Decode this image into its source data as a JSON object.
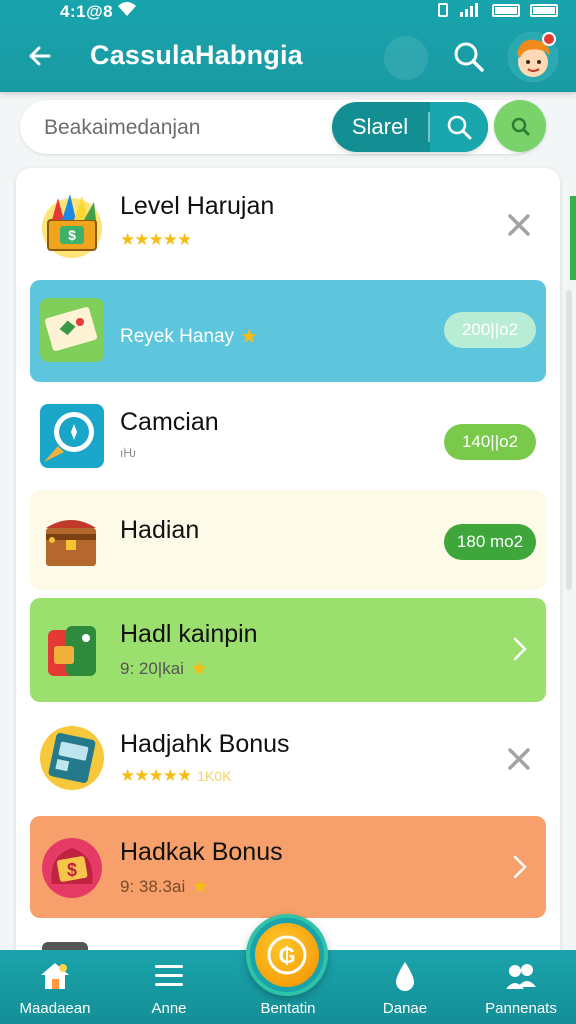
{
  "status_bar": {
    "time": "4:1@8"
  },
  "app_bar": {
    "title": "CassulaHabngia"
  },
  "search": {
    "placeholder": "Beakaimedanjan",
    "button_label": "Slarel"
  },
  "items": [
    {
      "title": "Level Harujan",
      "subtitle": "",
      "stars": "★★★★★",
      "action": "close",
      "badge": ""
    },
    {
      "title": "",
      "subtitle": "Reyek Hanay",
      "stars": "★",
      "action": "badge",
      "badge": "200||o2"
    },
    {
      "title": "Camcian",
      "subtitle": "ıׂǶ",
      "stars": "",
      "action": "badge",
      "badge": "140||o2"
    },
    {
      "title": "Hadian",
      "subtitle": "",
      "stars": "",
      "action": "badge",
      "badge": "180 mo2"
    },
    {
      "title": "Hadl kainpin",
      "subtitle": "9: 20|kai",
      "stars": "★",
      "action": "chevron",
      "badge": ""
    },
    {
      "title": "Hadjahk Bonus",
      "subtitle": "",
      "stars": "★★★★★",
      "stars_tail": "1K0K",
      "action": "close",
      "badge": ""
    },
    {
      "title": "Hadkak Bonus",
      "subtitle": "9: 38.3ai",
      "stars": "★",
      "action": "chevron",
      "badge": ""
    }
  ],
  "bottom_nav": {
    "items": [
      {
        "label": "Maadaean",
        "icon": "home-icon"
      },
      {
        "label": "Anne",
        "icon": "list-icon"
      },
      {
        "label": "Bentatin",
        "icon": "coin-icon"
      },
      {
        "label": "Danae",
        "icon": "drop-icon"
      },
      {
        "label": "Pannenats",
        "icon": "people-icon"
      }
    ]
  },
  "colors": {
    "primary": "#18a4ad",
    "accent_green": "#79d26a",
    "row_blue": "#5ec6dc",
    "row_cream": "#fdfbe8",
    "row_green": "#9bdf6e",
    "row_orange": "#f7a06b",
    "badge_green": "#79c94b",
    "badge_darkgreen": "#3ea63a"
  }
}
